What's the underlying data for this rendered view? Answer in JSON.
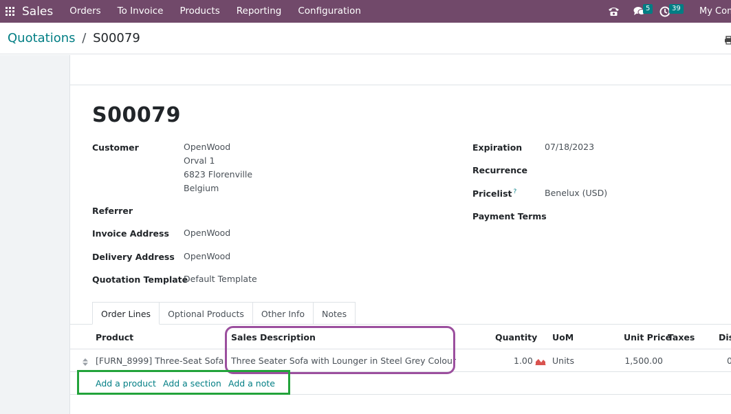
{
  "navbar": {
    "brand": "Sales",
    "menu": [
      "Orders",
      "To Invoice",
      "Products",
      "Reporting",
      "Configuration"
    ],
    "messages_count": "5",
    "activities_count": "39",
    "company": "My Com",
    "bg_color": "#71496a"
  },
  "breadcrumb": {
    "parent": "Quotations",
    "separator": "/",
    "current": "S00079"
  },
  "record": {
    "name": "S00079"
  },
  "fields_left": {
    "customer_label": "Customer",
    "customer_lines": [
      "OpenWood",
      "Orval 1",
      "6823 Florenville",
      "Belgium"
    ],
    "referrer_label": "Referrer",
    "invoice_address_label": "Invoice Address",
    "invoice_address_value": "OpenWood",
    "delivery_address_label": "Delivery Address",
    "delivery_address_value": "OpenWood",
    "quotation_template_label": "Quotation Template",
    "quotation_template_value": "Default Template"
  },
  "fields_right": {
    "expiration_label": "Expiration",
    "expiration_value": "07/18/2023",
    "recurrence_label": "Recurrence",
    "pricelist_label": "Pricelist",
    "pricelist_help": "?",
    "pricelist_value": "Benelux (USD)",
    "payment_terms_label": "Payment Terms"
  },
  "tabs": [
    "Order Lines",
    "Optional Products",
    "Other Info",
    "Notes"
  ],
  "order_lines": {
    "columns": [
      "Product",
      "Sales Description",
      "Quantity",
      "UoM",
      "Unit Price",
      "Taxes",
      "Disc"
    ],
    "rows": [
      {
        "product": "[FURN_8999] Three-Seat Sofa",
        "description": "Three Seater Sofa with Lounger in Steel Grey Colour",
        "quantity": "1.00",
        "uom": "Units",
        "unit_price": "1,500.00",
        "taxes": "",
        "discount": "0"
      }
    ],
    "add_links": [
      "Add a product",
      "Add a section",
      "Add a note"
    ]
  },
  "colors": {
    "accent": "#017e84",
    "highlight_purple": "#9b4f9e",
    "highlight_green": "#22a33a",
    "forecast_icon": "#d9534f"
  }
}
